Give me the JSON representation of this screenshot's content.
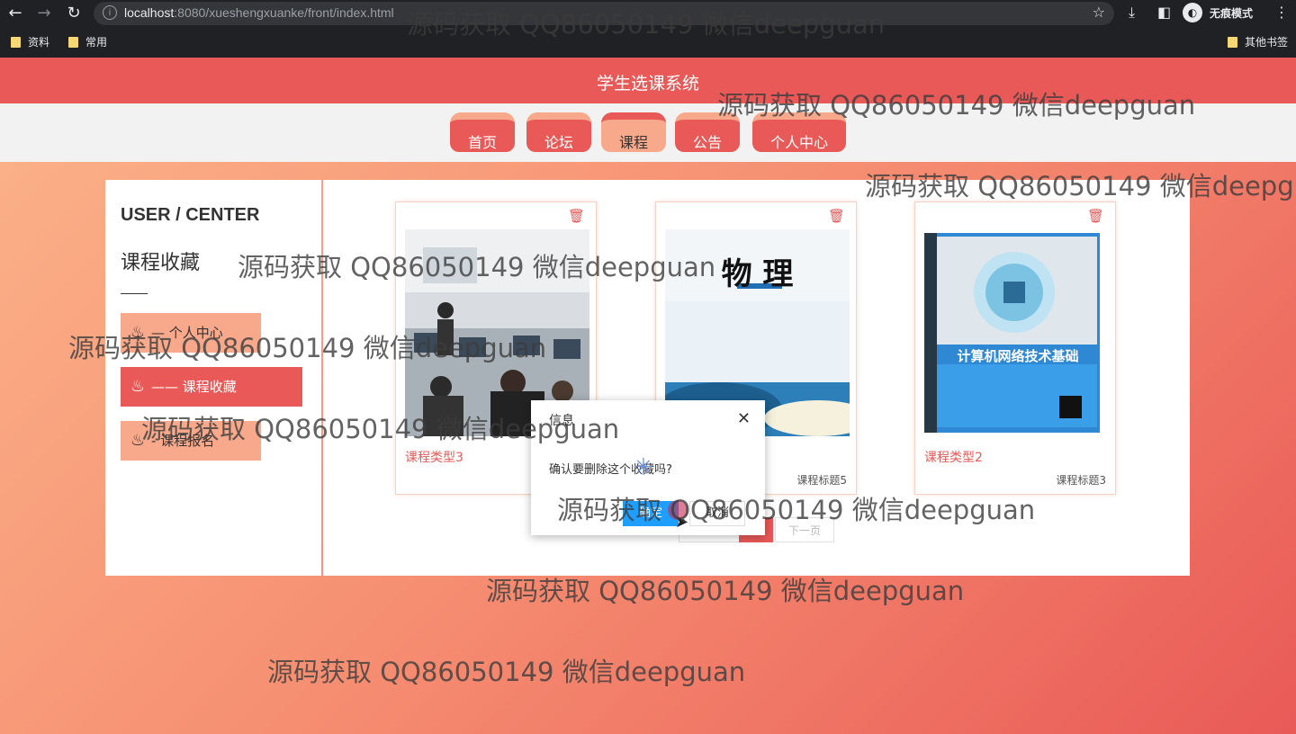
{
  "browser": {
    "url_host": "localhost",
    "url_rest": ":8080/xueshengxuanke/front/index.html",
    "incognito_label": "无痕模式",
    "bookmarks": [
      "资料",
      "常用"
    ],
    "other_bookmarks": "其他书签"
  },
  "site": {
    "title": "学生选课系统",
    "nav": [
      "首页",
      "论坛",
      "课程",
      "公告",
      "个人中心"
    ],
    "active_nav": "课程"
  },
  "sidebar": {
    "heading_en": "USER / CENTER",
    "heading_cn": "课程收藏",
    "items": [
      {
        "label": "个人中心",
        "prefix": "—"
      },
      {
        "label": "课程收藏",
        "prefix": "——"
      },
      {
        "label": "课程报名",
        "prefix": "-"
      }
    ],
    "active_item": "课程收藏"
  },
  "cards": [
    {
      "type": "课程类型3",
      "title": "",
      "image": "computer-lab-photo"
    },
    {
      "type": "",
      "title": "课程标题5",
      "image": "physics-textbook-cover",
      "cover_text": "物 理"
    },
    {
      "type": "课程类型2",
      "title": "课程标题3",
      "image": "network-textbook-cover",
      "cover_text": "计算机网络技术基础"
    }
  ],
  "pager": {
    "next": "下一页"
  },
  "dialog": {
    "title": "信息",
    "message": "确认要删除这个收藏吗?",
    "ok": "确定",
    "cancel": "取消"
  },
  "watermark": "源码获取 QQ86050149 微信deepguan",
  "colors": {
    "primary": "#e85957",
    "secondary": "#f9a98b",
    "dialog_ok": "#1e9fff"
  }
}
